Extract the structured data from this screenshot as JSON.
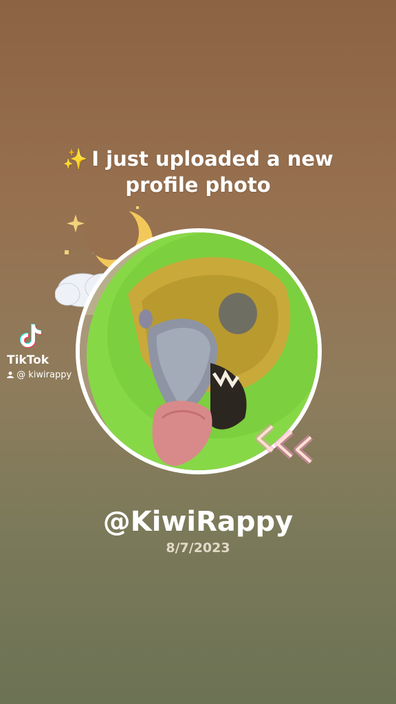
{
  "headline": {
    "emoji": "✨",
    "line1": "I just uploaded a new",
    "line2": "profile photo"
  },
  "watermark": {
    "brand": "TikTok",
    "handle": "@ kiwirappy"
  },
  "profile": {
    "username": "@KiwiRappy",
    "date": "8/7/2023"
  },
  "colors": {
    "bg_top": "#8c6444",
    "bg_bottom": "#6c7254",
    "moon": "#f3c85a",
    "fur": "#8bd94a",
    "chevron_glow": "#ff8fd8"
  },
  "icons": [
    "sparkle-icon",
    "moon-icon",
    "cloud-icon",
    "tiktok-logo-icon",
    "user-icon",
    "chevron-decoration-icon"
  ]
}
